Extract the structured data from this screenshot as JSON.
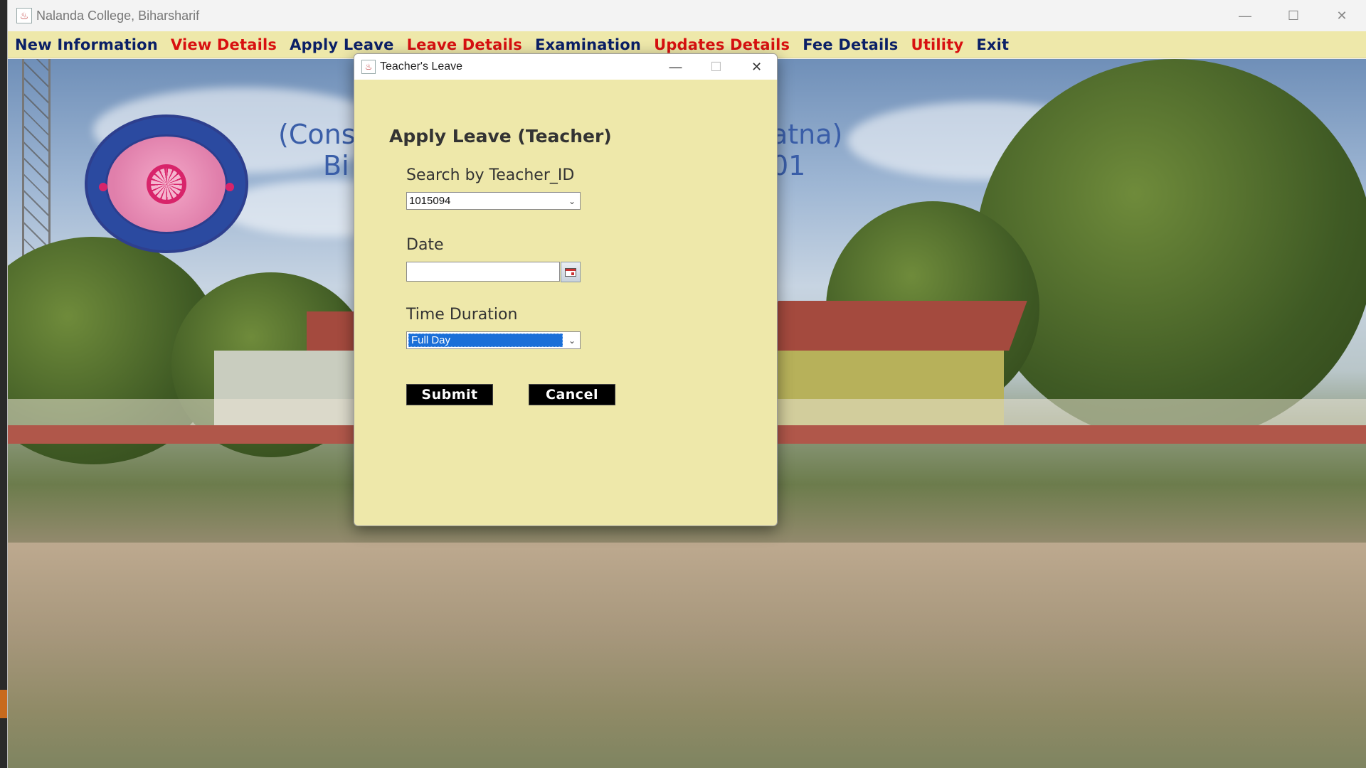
{
  "window": {
    "title": "Nalanda College, Biharsharif",
    "app_icon": "java-cup-icon"
  },
  "menu": [
    {
      "label": "New Information",
      "color": "#0a1f66"
    },
    {
      "label": "View Details",
      "color": "#d81010"
    },
    {
      "label": "Apply Leave",
      "color": "#0a1f66"
    },
    {
      "label": "Leave Details",
      "color": "#d81010"
    },
    {
      "label": "Examination",
      "color": "#0a1f66"
    },
    {
      "label": "Updates Details",
      "color": "#d81010"
    },
    {
      "label": "Fee Details",
      "color": "#0a1f66"
    },
    {
      "label": "Utility",
      "color": "#d81010"
    },
    {
      "label": "Exit",
      "color": "#0a1f66"
    }
  ],
  "background": {
    "line1_left": "(Const",
    "line1_right": "atna)",
    "line2_left": "Bi",
    "line2_right": "01"
  },
  "dialog": {
    "title": "Teacher's Leave",
    "heading": "Apply Leave (Teacher)",
    "teacher_label": "Search by Teacher_ID",
    "teacher_value": "1015094",
    "date_label": "Date",
    "date_value": "",
    "duration_label": "Time Duration",
    "duration_value": "Full Day",
    "submit_label": "Submit",
    "cancel_label": "Cancel"
  },
  "colors": {
    "panel_bg": "#eee8aa",
    "menu_blue": "#0a1f66",
    "menu_red": "#d81010",
    "button_bg": "#000000",
    "selection": "#1a6fd8"
  }
}
